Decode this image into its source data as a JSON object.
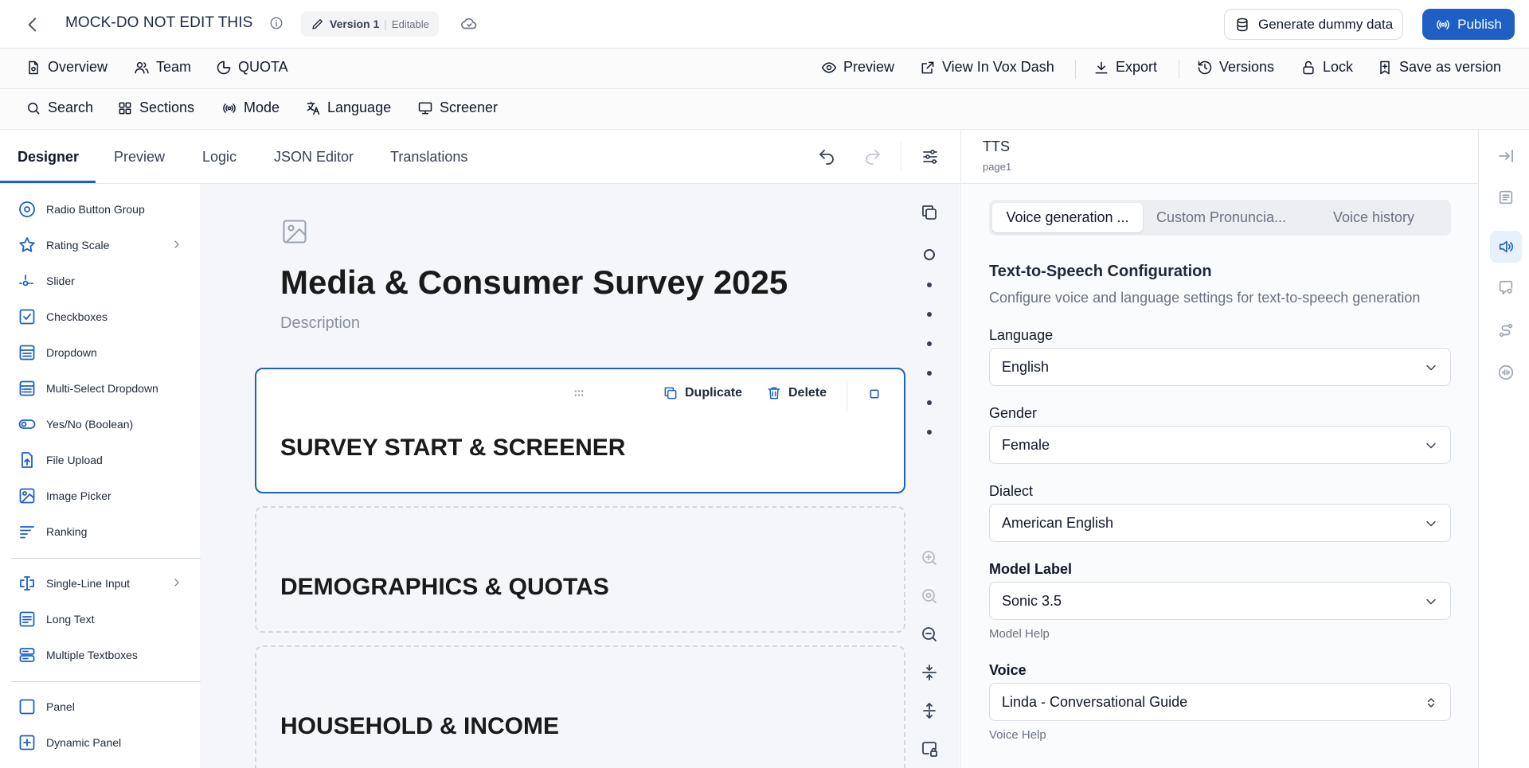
{
  "header": {
    "survey_title": "MOCK-DO NOT EDIT THIS",
    "version_label": "Version 1",
    "version_state": "Editable",
    "generate_label": "Generate dummy data",
    "publish_label": "Publish"
  },
  "nav1": {
    "overview": "Overview",
    "team": "Team",
    "quota": "QUOTA",
    "preview": "Preview",
    "view_in_vox": "View In Vox Dash",
    "export": "Export",
    "versions": "Versions",
    "lock": "Lock",
    "save_as_version": "Save as version"
  },
  "nav2": {
    "search": "Search",
    "sections": "Sections",
    "mode": "Mode",
    "language": "Language",
    "screener": "Screener"
  },
  "tabs": {
    "designer": "Designer",
    "preview": "Preview",
    "logic": "Logic",
    "json_editor": "JSON Editor",
    "translations": "Translations"
  },
  "toolbox": {
    "items": [
      "Radio Button Group",
      "Rating Scale",
      "Slider",
      "Checkboxes",
      "Dropdown",
      "Multi-Select Dropdown",
      "Yes/No (Boolean)",
      "File Upload",
      "Image Picker",
      "Ranking",
      "Single-Line Input",
      "Long Text",
      "Multiple Textboxes",
      "Panel",
      "Dynamic Panel"
    ]
  },
  "canvas": {
    "survey_title": "Media & Consumer Survey 2025",
    "description": "Description",
    "duplicate": "Duplicate",
    "delete": "Delete",
    "pages": [
      "SURVEY START & SCREENER",
      "DEMOGRAPHICS & QUOTAS",
      "HOUSEHOLD & INCOME"
    ]
  },
  "panel": {
    "title": "TTS",
    "subtitle": "page1",
    "seg_voice_gen": "Voice generation ...",
    "seg_custom": "Custom Pronuncia...",
    "seg_history": "Voice history",
    "config_title": "Text-to-Speech Configuration",
    "config_desc": "Configure voice and language settings for text-to-speech generation",
    "language_label": "Language",
    "language_value": "English",
    "gender_label": "Gender",
    "gender_value": "Female",
    "dialect_label": "Dialect",
    "dialect_value": "American English",
    "model_label": "Model Label",
    "model_value": "Sonic 3.5",
    "model_help": "Model Help",
    "voice_label": "Voice",
    "voice_value": "Linda - Conversational Guide",
    "voice_help": "Voice Help"
  },
  "colors": {
    "accent": "#1d5fc4",
    "canvas_bg": "#f4f6f9"
  }
}
